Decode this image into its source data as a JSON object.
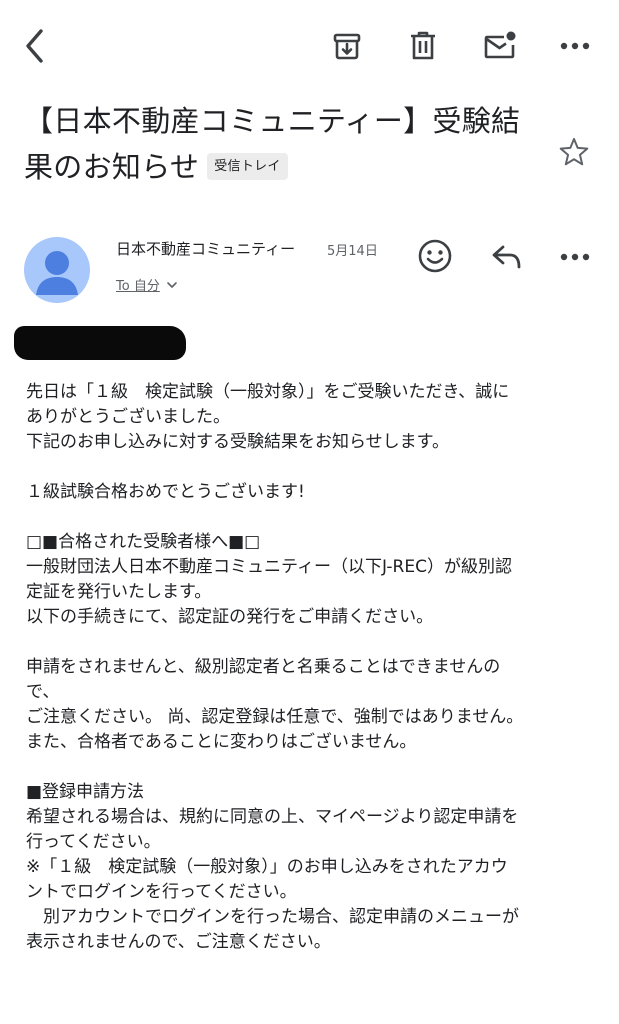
{
  "toolbar": {
    "back_icon": "back-arrow-icon",
    "archive_icon": "archive-icon",
    "delete_icon": "trash-icon",
    "mark_unread_icon": "mail-unread-icon",
    "more_icon": "more-horizontal-icon"
  },
  "email": {
    "subject": "【日本不動産コミュニティー】受験結果のお知らせ",
    "label": "受信トレイ",
    "starred": false,
    "sender": {
      "name": "日本不動産コミュニティー",
      "date": "5月14日",
      "recipient": "To 自分"
    },
    "body_lines": [
      "先日は「１級　検定試験（一般対象）」をご受験いただき、誠に",
      "ありがとうございました。",
      "下記のお申し込みに対する受験結果をお知らせします。",
      "",
      "１級試験合格おめでとうございます!",
      "",
      "□■合格された受験者様へ■□",
      "一般財団法人日本不動産コミュニティー（以下J-REC）が級別認",
      "定証を発行いたします。",
      "以下の手続きにて、認定証の発行をご申請ください。",
      "",
      "申請をされませんと、級別認定者と名乗ることはできませんの",
      "で、",
      "ご注意ください。 尚、認定登録は任意で、強制ではありません。",
      "また、合格者であることに変わりはございません。",
      "",
      "■登録申請方法",
      "希望される場合は、規約に同意の上、マイページより認定申請を",
      "行ってください。",
      "※「１級　検定試験（一般対象）」のお申し込みをされたアカウ",
      "ントでログインを行ってください。",
      "　別アカウントでログインを行った場合、認定申請のメニューが",
      "表示されませんので、ご注意ください。"
    ]
  },
  "colors": {
    "avatar_bg": "#a8c7fa",
    "avatar_fg": "#4c7fe0",
    "chip_bg": "#ececec",
    "text": "#202124",
    "secondary": "#5f6368"
  }
}
